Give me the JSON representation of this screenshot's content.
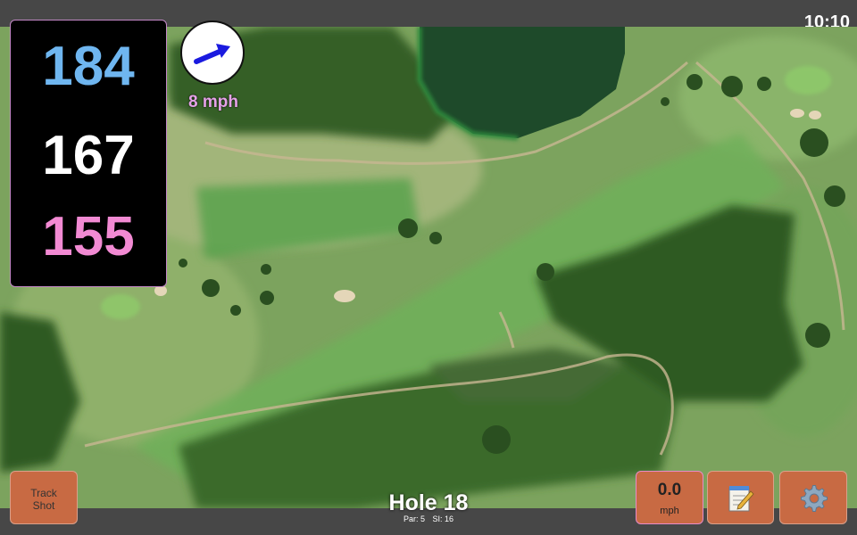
{
  "clock": "10:10",
  "distances": {
    "back": "184",
    "middle": "167",
    "front": "155",
    "colors": {
      "back": "#6fb6f0",
      "middle": "#ffffff",
      "front": "#f28ad3"
    }
  },
  "wind": {
    "speed": "8 mph",
    "arrow_color": "#1a1adf"
  },
  "buttons": {
    "track_shot": {
      "line1": "Track",
      "line2": "Shot"
    },
    "speed": {
      "value": "0.0",
      "unit": "mph"
    },
    "notes_icon": "notepad-icon",
    "settings_icon": "gear-icon"
  },
  "hole": {
    "title": "Hole 18",
    "par": "Par: 5",
    "si": "SI: 16"
  },
  "colors": {
    "button": "#c86a43",
    "panel": "#000000",
    "bar": "#474747"
  }
}
